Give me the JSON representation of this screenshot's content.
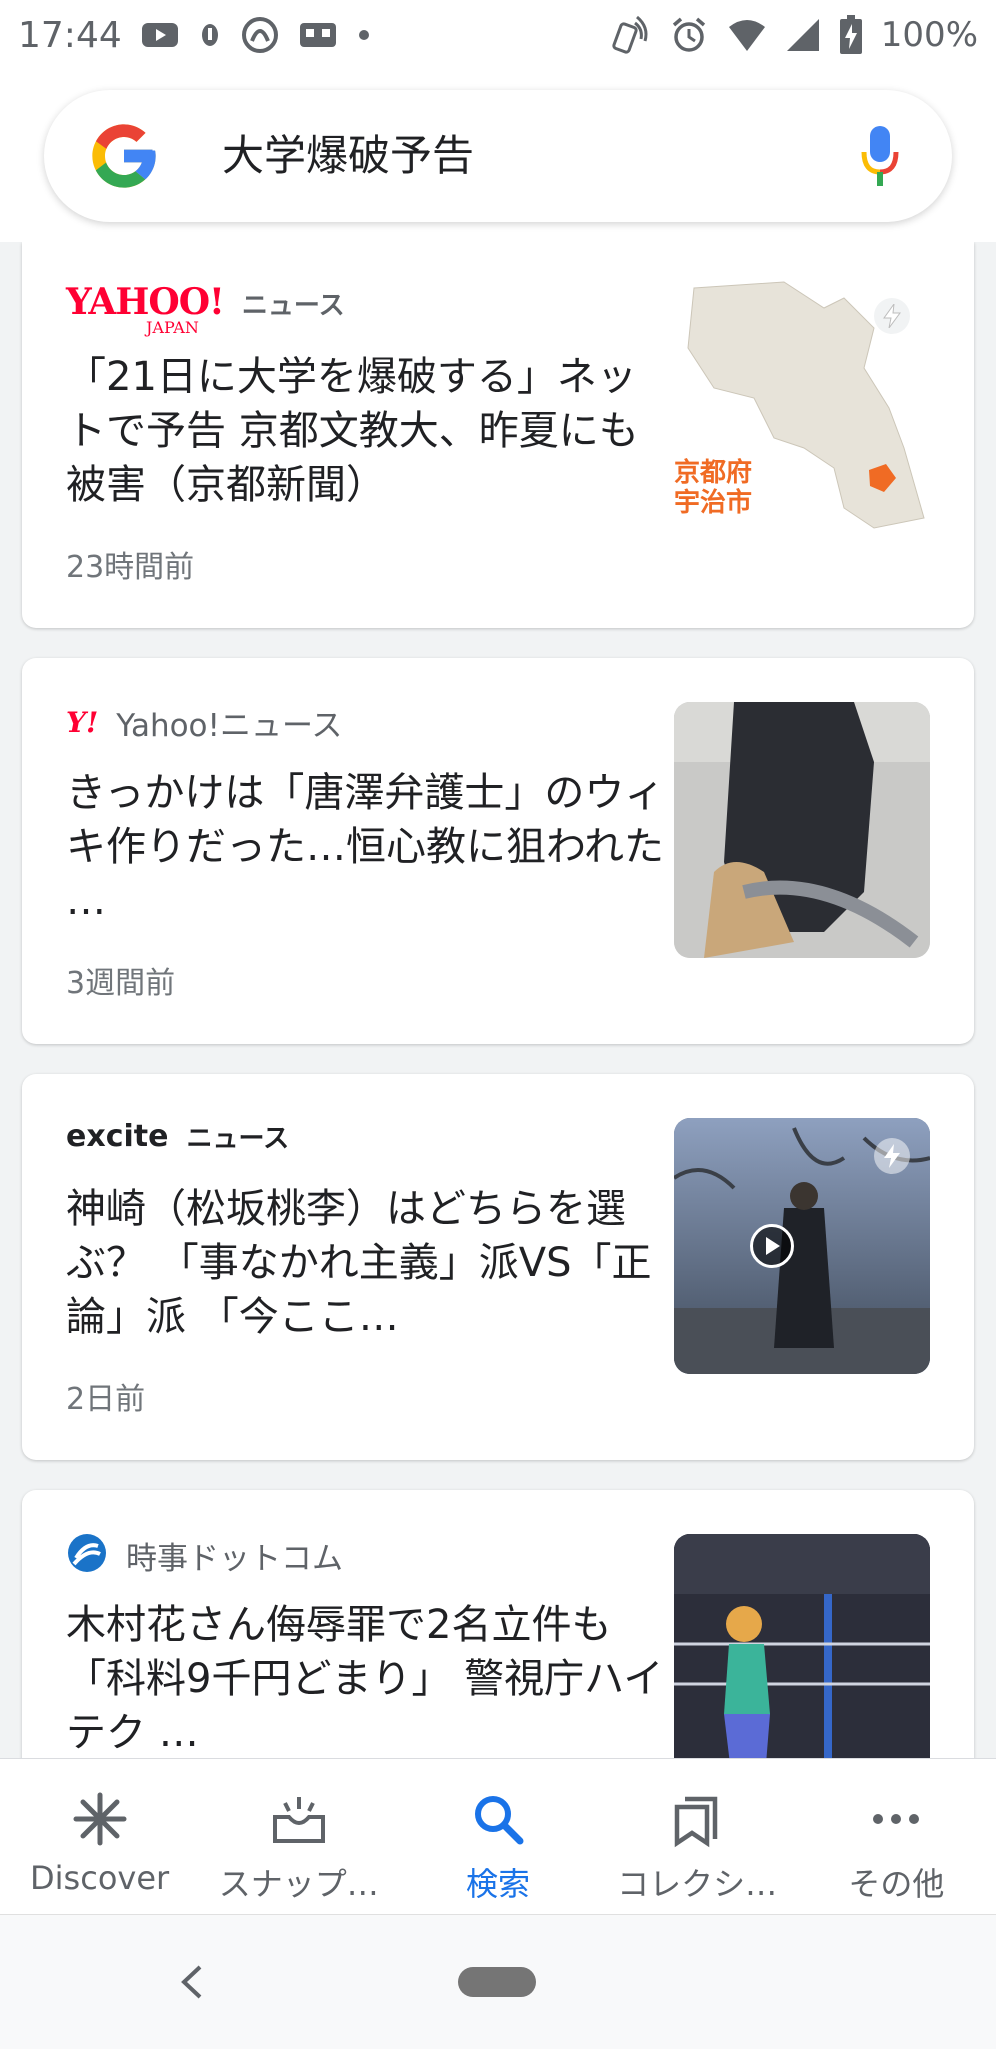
{
  "status_bar": {
    "time": "17:44",
    "battery": "100%",
    "icons": [
      "youtube-icon",
      "notification-icon",
      "app-icon",
      "photo-icon",
      "dot-icon",
      "nfc-icon",
      "alarm-icon",
      "wifi-icon",
      "signal-icon",
      "battery-charging-icon"
    ]
  },
  "search": {
    "query": "大学爆破予告",
    "logo_icon": "google-g-icon",
    "mic_icon": "mic-icon"
  },
  "articles": [
    {
      "source": "ニュース",
      "source_logo": "YAHOO!",
      "source_logo_sub": "JAPAN",
      "headline": "「21日に大学を爆破する」ネットで予告 京都文教大、昨夏にも被害（京都新聞）",
      "time_ago": "23時間前",
      "thumb_caption": "京都府\n宇治市",
      "thumb_icon": "amp-lightning-icon"
    },
    {
      "source": "Yahoo!ニュース",
      "source_logo": "Y!",
      "headline": "きっかけは「唐澤弁護士」のウィキ作りだった…恒心教に狙われた …",
      "time_ago": "3週間前"
    },
    {
      "source": "ニュース",
      "source_logo": "excite",
      "headline": "神崎（松坂桃李）はどちらを選ぶ？ 「事なかれ主義」派VS「正論」派 「今ここ…",
      "time_ago": "2日前",
      "thumb_icon": "play-icon"
    },
    {
      "source": "時事ドットコム",
      "headline": "木村花さん侮辱罪で2名立件も「科料9千円どまり」 警視庁ハイテク …"
    }
  ],
  "bottom_nav": [
    {
      "label": "Discover",
      "icon": "asterisk-icon",
      "active": false
    },
    {
      "label": "スナップ…",
      "icon": "snapshot-tray-icon",
      "active": false
    },
    {
      "label": "検索",
      "icon": "search-icon",
      "active": true
    },
    {
      "label": "コレクシ…",
      "icon": "bookmark-collection-icon",
      "active": false
    },
    {
      "label": "その他",
      "icon": "more-horiz-icon",
      "active": false
    }
  ],
  "colors": {
    "accent": "#1a73e8",
    "yahoo_red": "#ff0033",
    "google_blue": "#4285f4",
    "google_red": "#ea4335",
    "google_yellow": "#fbbc05",
    "google_green": "#34a853"
  }
}
